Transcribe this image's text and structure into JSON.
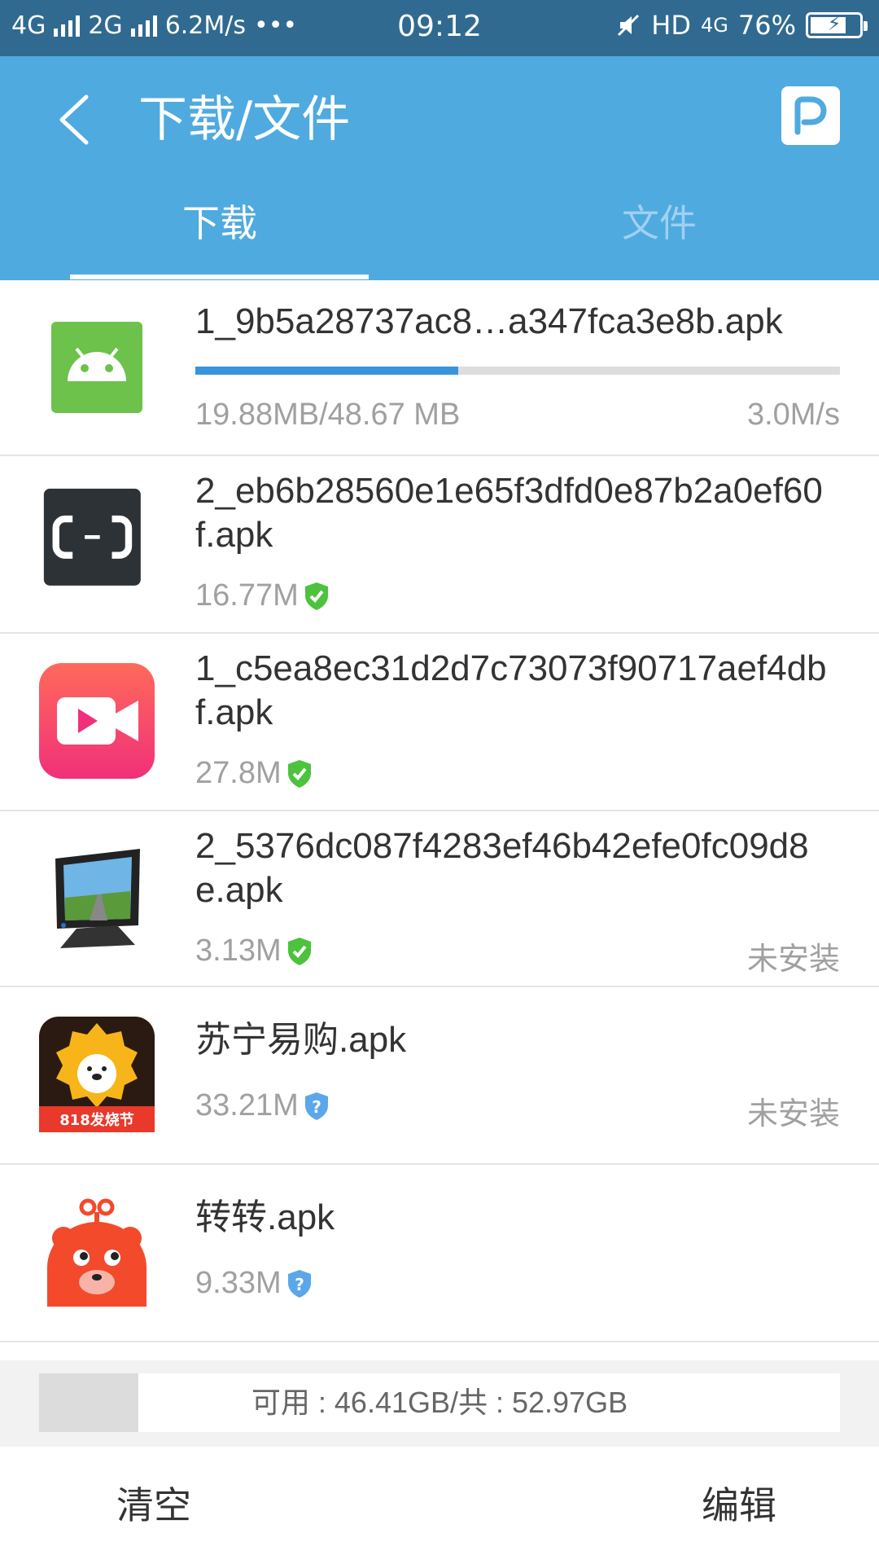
{
  "status_bar": {
    "left": "4G",
    "left2": "2G",
    "speed": "6.2M/s",
    "dots": "•••",
    "time": "09:12",
    "hd": "HD",
    "net": "4G",
    "battery": "76%",
    "battery_level": 0.76
  },
  "header": {
    "title": "下载/文件",
    "tabs": [
      {
        "label": "下载",
        "active": true
      },
      {
        "label": "文件",
        "active": false
      }
    ]
  },
  "downloads": [
    {
      "name": "1_9b5a28737ac8…a347fca3e8b.apk",
      "icon": "android-icon",
      "progress": 0.408,
      "size": "19.88MB/48.67 MB",
      "speed": "3.0M/s"
    },
    {
      "name": "2_eb6b28560e1e65f3dfd0e87b2a0ef60f.apk",
      "icon": "aliyun-app-icon",
      "size": "16.77M",
      "badge": "verified-shield-icon"
    },
    {
      "name": "1_c5ea8ec31d2d7c73073f90717aef4dbf.apk",
      "icon": "video-camera-app-icon",
      "size": "27.8M",
      "badge": "verified-shield-icon"
    },
    {
      "name": "2_5376dc087f4283ef46b42efe0fc09d8e.apk",
      "icon": "monitor-app-icon",
      "size": "3.13M",
      "badge": "verified-shield-icon",
      "status": "未安装"
    },
    {
      "name": "苏宁易购.apk",
      "icon": "suning-lion-icon",
      "icon_text": "818发烧节",
      "size": "33.21M",
      "badge": "unknown-shield-icon",
      "status": "未安装"
    },
    {
      "name": "转转.apk",
      "icon": "zhuanzhuan-bear-icon",
      "size": "9.33M",
      "badge": "unknown-shield-icon"
    }
  ],
  "storage": {
    "text": "可用 : 46.41GB/共 : 52.97GB",
    "used_fraction": 0.124
  },
  "bottom": {
    "clear": "清空",
    "edit": "编辑"
  },
  "colors": {
    "status_bar": "#306a90",
    "app_bar": "#4faae0",
    "progress": "#3a94dc",
    "verified": "#4cc23d",
    "unknown": "#5aa7ea"
  }
}
